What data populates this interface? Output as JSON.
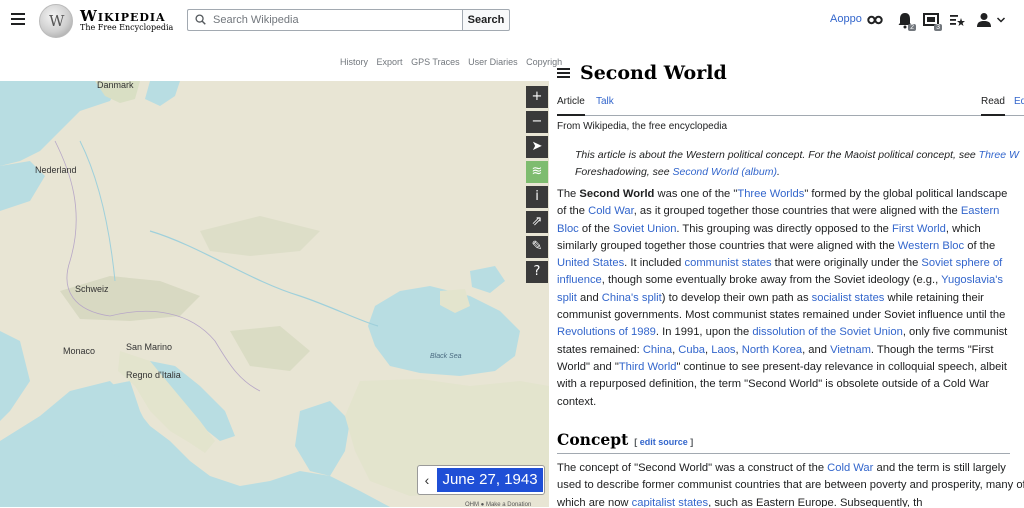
{
  "header": {
    "wordmark": "Wikipedia",
    "tagline": "The Free Encyclopedia",
    "search_placeholder": "Search Wikipedia",
    "search_button": "Search",
    "username": "Aoppo",
    "notif_alerts_count": "2",
    "notif_notices_count": "3"
  },
  "map": {
    "toolbar_links": [
      "History",
      "Export",
      "GPS Traces",
      "User Diaries",
      "Copyrigh"
    ],
    "labels": {
      "danmark": "Danmark",
      "nederland": "Nederland",
      "schweiz": "Schweiz",
      "san_marino": "San Marino",
      "monaco": "Monaco",
      "regno": "Regno d'Italia",
      "black_sea": "Black Sea"
    },
    "controls": [
      "+",
      "−",
      "➤",
      "≋",
      "i",
      "⇗",
      "✎",
      "?"
    ],
    "date": "June 27, 1943",
    "date_prev": "‹",
    "attribution": "OHM ● Make a Donation"
  },
  "article": {
    "title": "Second World",
    "tabs": {
      "article": "Article",
      "talk": "Talk",
      "read": "Read",
      "edit": "Ed"
    },
    "from": "From Wikipedia, the free encyclopedia",
    "hatnote_line1_pre": "This article is about the Western political concept. For the Maoist political concept, see ",
    "hatnote_line1_link": "Three W",
    "hatnote_line2_pre": "Foreshadowing, see ",
    "hatnote_line2_link": "Second World (album)",
    "hatnote_line2_post": ".",
    "section_concept": "Concept",
    "edit_source": "edit source"
  }
}
